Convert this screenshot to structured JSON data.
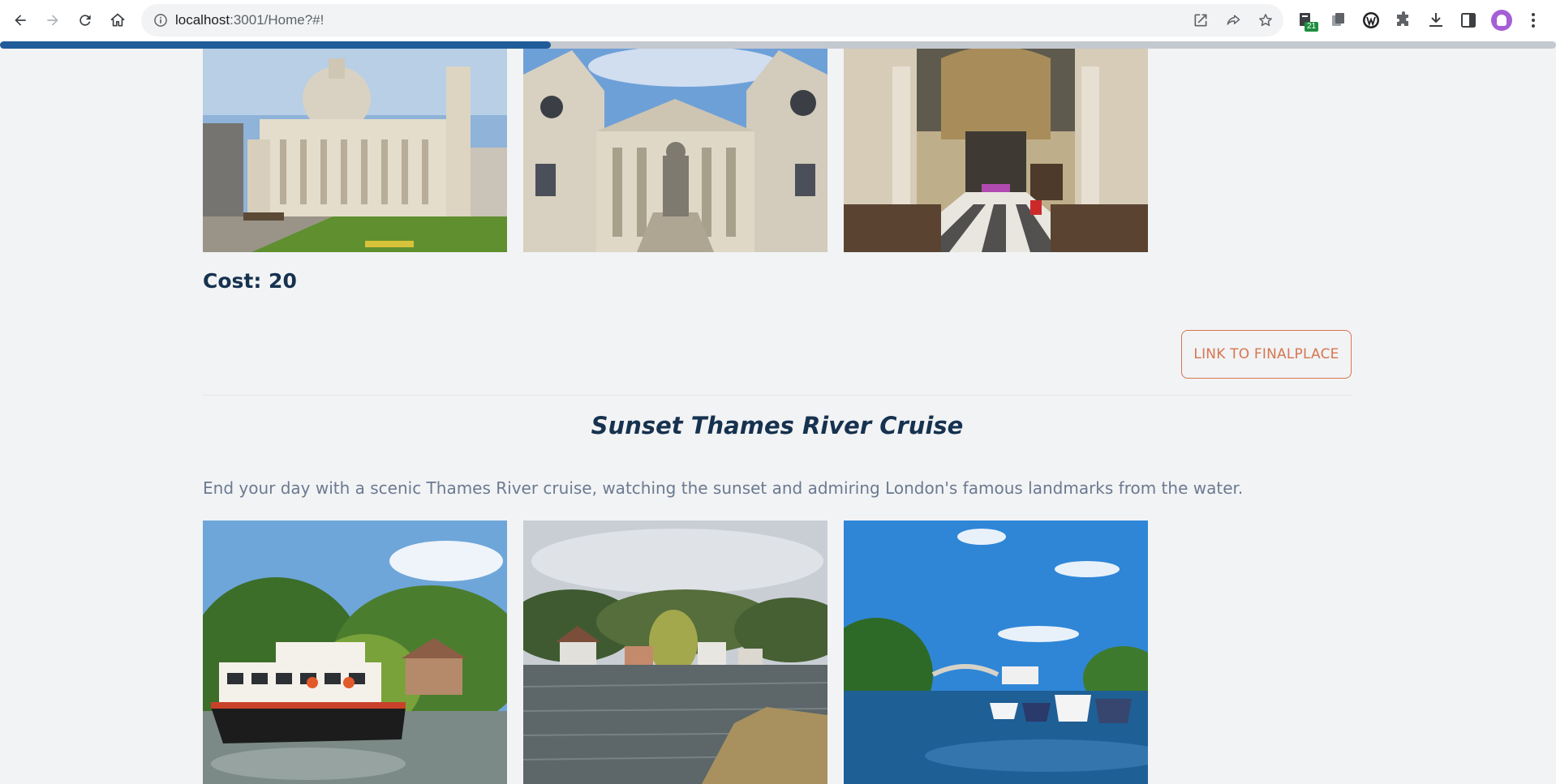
{
  "browser": {
    "url_host": "localhost",
    "url_rest": ":3001/Home?#!",
    "extension_badge": "21"
  },
  "page_progress": 0.354,
  "top_gallery": {
    "images": [
      {
        "alt": "St Paul's Cathedral exterior with dome"
      },
      {
        "alt": "St Paul's Cathedral facade with statue"
      },
      {
        "alt": "St Paul's Cathedral interior nave"
      }
    ]
  },
  "cost": {
    "label": "Cost: 20"
  },
  "link_button": {
    "label": "LINK TO FINALPLACE"
  },
  "section": {
    "title": "Sunset Thames River Cruise",
    "description": "End your day with a scenic Thames River cruise, watching the sunset and admiring London's famous landmarks from the water."
  },
  "bottom_gallery": {
    "images": [
      {
        "alt": "River cruise boat on the Thames"
      },
      {
        "alt": "Riverside houses along the Thames"
      },
      {
        "alt": "Boats moored on the river under blue sky"
      }
    ]
  },
  "colors": {
    "heading": "#16324f",
    "accent": "#d6764f",
    "body_text": "#6b7a90",
    "progress": "#1f5c99"
  }
}
